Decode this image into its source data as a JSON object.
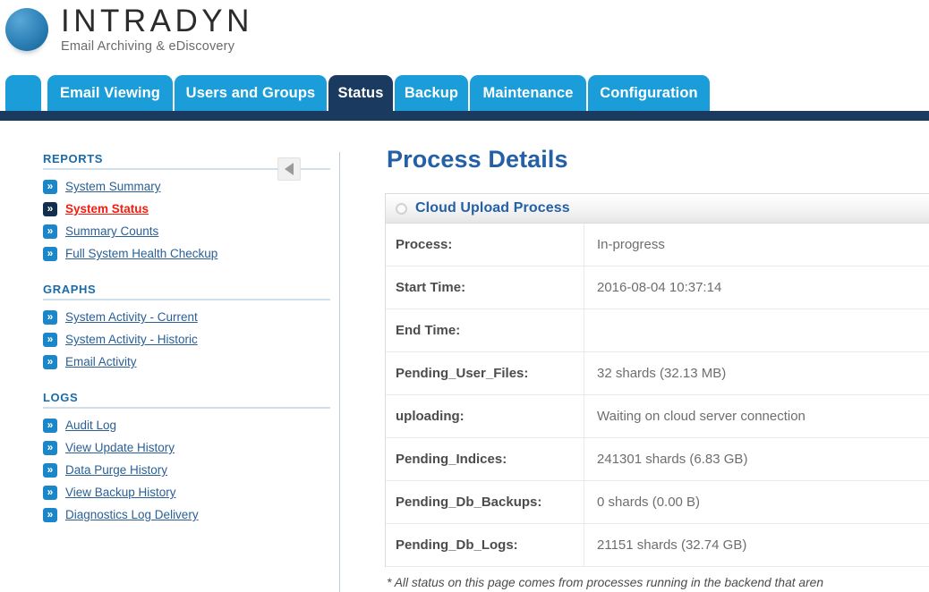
{
  "brand": {
    "name": "INTRADYN",
    "tagline": "Email Archiving & eDiscovery",
    "logo_icon": "blue-sphere-logo",
    "accent_blue": "#1b9dd9",
    "dark_navy": "#1b3a5f",
    "link_blue": "#2a5f96",
    "active_red": "#f31d0f"
  },
  "tabs": [
    {
      "label": "",
      "active": false,
      "stub": true
    },
    {
      "label": "Email Viewing",
      "active": false
    },
    {
      "label": "Users and Groups",
      "active": false
    },
    {
      "label": "Status",
      "active": true
    },
    {
      "label": "Backup",
      "active": false
    },
    {
      "label": "Maintenance",
      "active": false
    },
    {
      "label": "Configuration",
      "active": false
    }
  ],
  "sidebar": {
    "collapse_icon": "triangle-left-icon",
    "sections": [
      {
        "title": "REPORTS",
        "items": [
          {
            "label": "System Summary",
            "active": false
          },
          {
            "label": "System Status",
            "active": true
          },
          {
            "label": "Summary Counts",
            "active": false
          },
          {
            "label": "Full System Health Checkup",
            "active": false
          }
        ]
      },
      {
        "title": "GRAPHS",
        "items": [
          {
            "label": "System Activity - Current",
            "active": false
          },
          {
            "label": "System Activity - Historic",
            "active": false
          },
          {
            "label": "Email Activity",
            "active": false
          }
        ]
      },
      {
        "title": "LOGS",
        "items": [
          {
            "label": "Audit Log",
            "active": false
          },
          {
            "label": "View Update History",
            "active": false
          },
          {
            "label": "Data Purge History",
            "active": false
          },
          {
            "label": "View Backup History",
            "active": false
          },
          {
            "label": "Diagnostics Log Delivery",
            "active": false
          }
        ]
      }
    ]
  },
  "main": {
    "page_title": "Process Details",
    "panel": {
      "status_icon": "empty-circle-icon",
      "title": "Cloud Upload Process",
      "rows": [
        {
          "key": "Process:",
          "value": "In-progress"
        },
        {
          "key": "Start Time:",
          "value": "2016-08-04 10:37:14"
        },
        {
          "key": "End Time:",
          "value": ""
        },
        {
          "key": "Pending_User_Files:",
          "value": "32 shards (32.13 MB)"
        },
        {
          "key": "uploading:",
          "value": "Waiting on cloud server connection"
        },
        {
          "key": "Pending_Indices:",
          "value": "241301 shards (6.83 GB)"
        },
        {
          "key": "Pending_Db_Backups:",
          "value": "0 shards (0.00 B)"
        },
        {
          "key": "Pending_Db_Logs:",
          "value": "21151 shards (32.74 GB)"
        }
      ]
    },
    "footnote": "* All status on this page comes from processes running in the backend that aren"
  }
}
